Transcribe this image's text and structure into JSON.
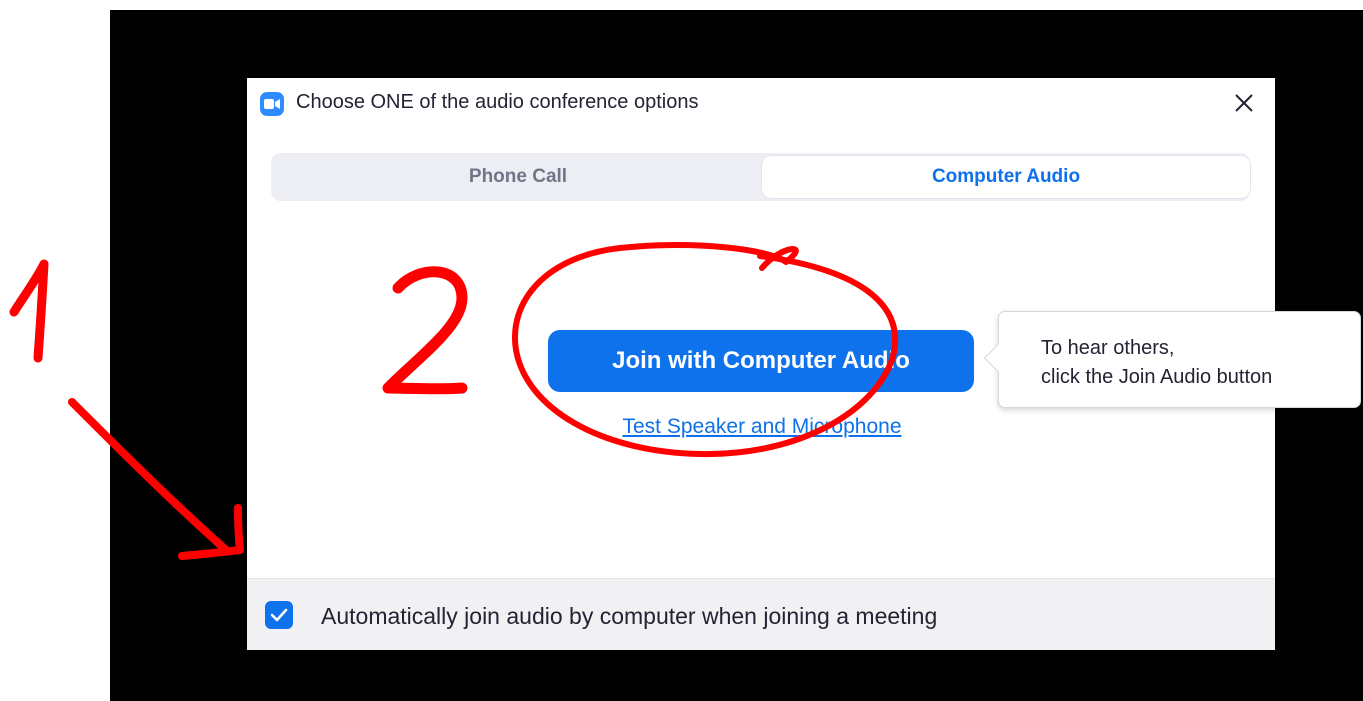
{
  "dialog": {
    "title": "Choose ONE of the audio conference options",
    "icon": "zoom-camera-icon",
    "close_icon": "close-icon"
  },
  "tabs": [
    {
      "label": "Phone Call",
      "selected": false
    },
    {
      "label": "Computer Audio",
      "selected": true
    }
  ],
  "main": {
    "join_button_label": "Join with Computer Audio",
    "test_link_label": "Test Speaker and Microphone"
  },
  "tooltip": {
    "line1": "To hear others,",
    "line2": "click the Join Audio button"
  },
  "footer": {
    "checkbox_checked": true,
    "checkbox_label": "Automatically join audio by computer when joining a meeting"
  },
  "annotations": {
    "label_1": "1",
    "label_2": "2",
    "color": "#ff0000"
  },
  "colors": {
    "accent": "#0e72ed",
    "backdrop": "#000000",
    "footer_bg": "#f1f1f4"
  }
}
